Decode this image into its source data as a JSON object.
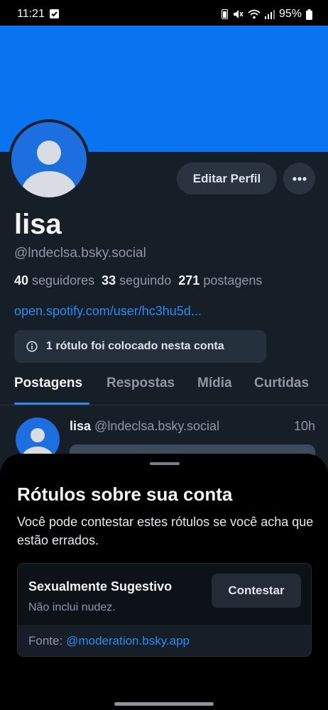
{
  "status_bar": {
    "time": "11:21",
    "battery": "95%"
  },
  "profile": {
    "edit_button": "Editar Perfil",
    "display_name": "lisa",
    "handle": "@lndeclsa.bsky.social",
    "stats": {
      "followers_count": "40",
      "followers_label": "seguidores",
      "following_count": "33",
      "following_label": "seguindo",
      "posts_count": "271",
      "posts_label": "postagens"
    },
    "link": "open.spotify.com/user/hc3hu5d...",
    "label_notice": "1 rótulo foi colocado nesta conta",
    "tabs": [
      {
        "label": "Postagens",
        "active": true
      },
      {
        "label": "Respostas",
        "active": false
      },
      {
        "label": "Mídia",
        "active": false
      },
      {
        "label": "Curtidas",
        "active": false
      }
    ]
  },
  "post": {
    "author": "lisa",
    "handle": "@lndeclsa.bsky.social",
    "time": "10h"
  },
  "sheet": {
    "title": "Rótulos sobre sua conta",
    "description": "Você pode contestar estes rótulos se você acha que estão errados.",
    "label_card": {
      "name": "Sexualmente Sugestivo",
      "subtitle": "Não inclui nudez.",
      "contest_button": "Contestar",
      "source_prefix": "Fonte:",
      "source_link": "@moderation.bsky.app"
    }
  },
  "colors": {
    "brand_blue": "#0a73f0",
    "link_blue": "#2a8bf2",
    "background": "#161e27"
  }
}
